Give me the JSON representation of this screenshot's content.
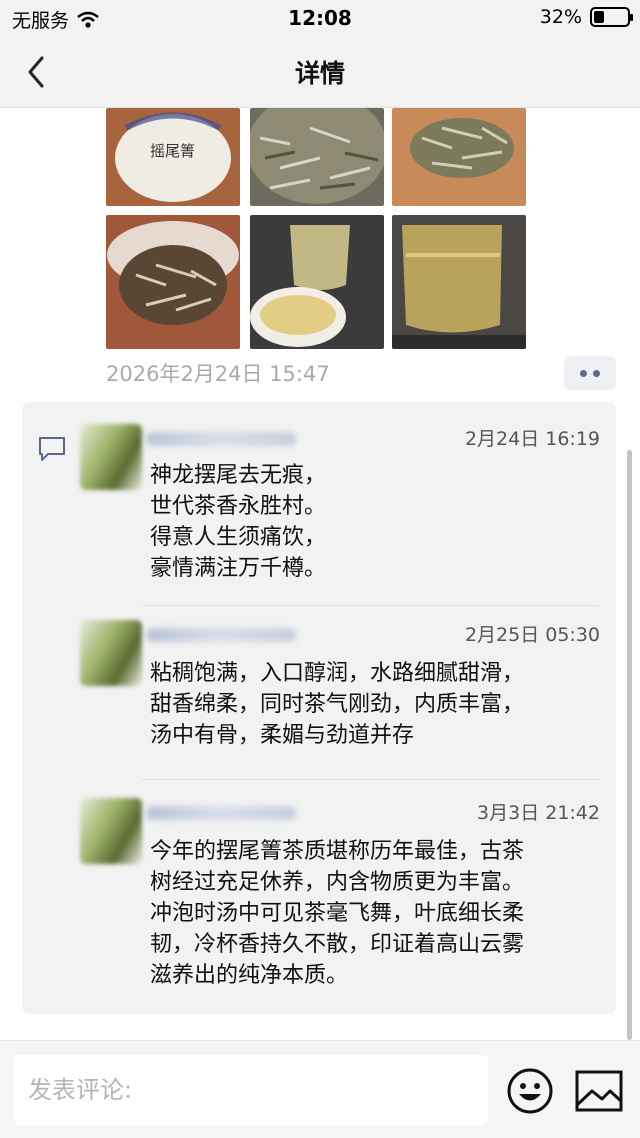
{
  "status_bar": {
    "carrier": "无服务",
    "time": "12:08",
    "battery": "32%",
    "battery_level": 0.32
  },
  "nav": {
    "title": "详情",
    "back_icon": "chevron-left-icon"
  },
  "post": {
    "photos": [
      {
        "name": "tea-cake-wrapped",
        "caption": "摇尾箐"
      },
      {
        "name": "tea-cake-unwrapped"
      },
      {
        "name": "loose-tea-leaves"
      },
      {
        "name": "tea-in-clay-pot"
      },
      {
        "name": "tea-in-glass-and-cup"
      },
      {
        "name": "tea-glass-pitcher"
      }
    ],
    "time": "2026年2月24日 15:47",
    "more_icon": "more-dots-icon"
  },
  "comments": [
    {
      "time": "2月24日 16:19",
      "lines": [
        "神龙摆尾去无痕，",
        "世代茶香永胜村。",
        "得意人生须痛饮，",
        "豪情满注万千樽。"
      ]
    },
    {
      "time": "2月25日 05:30",
      "lines": [
        "粘稠饱满，入口醇润，水路细腻甜滑，",
        "甜香绵柔，同时茶气刚劲，内质丰富，",
        "汤中有骨，柔媚与劲道并存"
      ]
    },
    {
      "time": "3月3日 21:42",
      "lines": [
        "今年的摆尾箐茶质堪称历年最佳，古茶",
        "树经过充足休养，内含物质更为丰富。",
        "冲泡时汤中可见茶毫飞舞，叶底细长柔",
        "韧，冷杯香持久不散，印证着高山云雾",
        "滋养出的纯净本质。"
      ]
    }
  ],
  "comment_bar": {
    "placeholder": "发表评论:",
    "emoji_icon": "emoji-icon",
    "image_icon": "image-icon"
  }
}
